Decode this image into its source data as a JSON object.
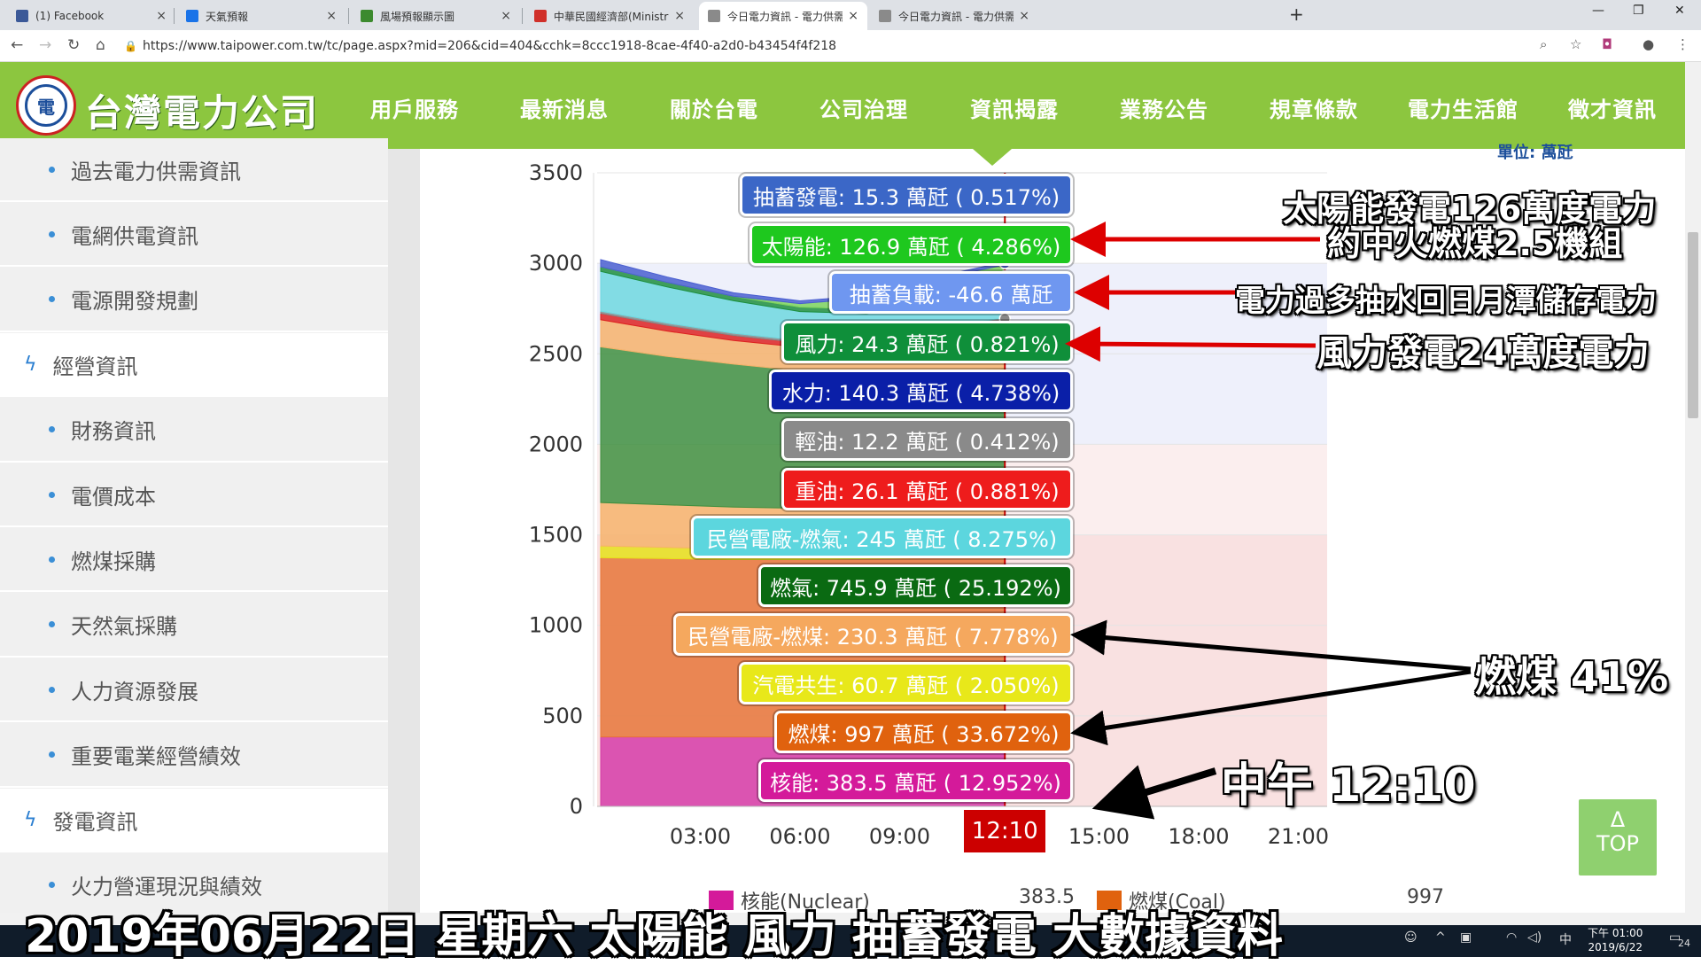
{
  "browser": {
    "tabs": [
      {
        "title": "(1) Facebook",
        "icon_color": "#3b5998",
        "active": false
      },
      {
        "title": "天氣預報",
        "icon_color": "#1a73e8",
        "active": false
      },
      {
        "title": "風場預報顯示圖",
        "icon_color": "#3c8a2e",
        "active": false
      },
      {
        "title": "中華民國經濟部(Ministry of Econ",
        "icon_color": "#d0302a",
        "active": false
      },
      {
        "title": "今日電力資訊 - 電力供需資訊 - 台",
        "icon_color": "#8a8a8a",
        "active": true
      },
      {
        "title": "今日電力資訊 - 電力供需資訊 - 台",
        "icon_color": "#8a8a8a",
        "active": false
      }
    ],
    "url": "https://www.taipower.com.tw/tc/page.aspx?mid=206&cid=404&cchk=8ccc1918-8cae-4f40-a2d0-b43454f4f218",
    "window": {
      "minimize": "—",
      "maximize": "❐",
      "close": "✕"
    }
  },
  "site": {
    "logo_text": "台灣電力公司",
    "logo_mark": "電",
    "menu": [
      "用戶服務",
      "最新消息",
      "關於台電",
      "公司治理",
      "資訊揭露",
      "業務公告",
      "規章條款",
      "電力生活館",
      "徵才資訊"
    ],
    "active_menu": "資訊揭露"
  },
  "sidebar": [
    {
      "label": "過去電力供需資訊",
      "type": "sub"
    },
    {
      "label": "電網供電資訊",
      "type": "sub"
    },
    {
      "label": "電源開發規劃",
      "type": "sub"
    },
    {
      "label": "經營資訊",
      "type": "cat"
    },
    {
      "label": "財務資訊",
      "type": "sub"
    },
    {
      "label": "電價成本",
      "type": "sub"
    },
    {
      "label": "燃煤採購",
      "type": "sub"
    },
    {
      "label": "天然氣採購",
      "type": "sub"
    },
    {
      "label": "人力資源發展",
      "type": "sub"
    },
    {
      "label": "重要電業經營績效",
      "type": "sub"
    },
    {
      "label": "發電資訊",
      "type": "cat"
    },
    {
      "label": "火力營運現況與績效",
      "type": "sub"
    }
  ],
  "unit_label": "單位: 萬瓩",
  "chart_data": {
    "type": "area",
    "title": "",
    "ylabel": "",
    "ylim": [
      0,
      3500
    ],
    "yticks": [
      0,
      500,
      1000,
      1500,
      2000,
      2500,
      3000,
      3500
    ],
    "xticks": [
      "03:00",
      "06:00",
      "09:00",
      "12:10",
      "15:00",
      "18:00",
      "21:00"
    ],
    "current_time": "12:10",
    "x": [
      "00:00",
      "02:00",
      "04:00",
      "06:00",
      "08:00",
      "10:00",
      "12:10"
    ],
    "stack_order": [
      "核能",
      "燃煤",
      "汽電共生",
      "民營電廠-燃煤",
      "燃氣",
      "民營電廠-燃氣",
      "重油",
      "輕油",
      "水力",
      "風力",
      "太陽能",
      "抽蓄發電"
    ],
    "series": [
      {
        "name": "核能",
        "color": "#d63ba8",
        "values": [
          383.5,
          383.5,
          383.5,
          383.5,
          383.5,
          383.5,
          383.5
        ]
      },
      {
        "name": "燃煤",
        "color": "#e8763a",
        "values": [
          990,
          985,
          980,
          980,
          985,
          990,
          997
        ]
      },
      {
        "name": "汽電共生",
        "color": "#e6e11a",
        "values": [
          65,
          62,
          60,
          58,
          59,
          60,
          60.7
        ]
      },
      {
        "name": "民營電廠-燃煤",
        "color": "#f6b26b",
        "values": [
          240,
          235,
          230,
          225,
          228,
          230,
          230.3
        ]
      },
      {
        "name": "燃氣",
        "color": "#3f8f3f",
        "values": [
          860,
          820,
          790,
          760,
          740,
          730,
          745.9
        ]
      },
      {
        "name": "民營電廠-燃氣",
        "color": "#f6b26b",
        "values": [
          150,
          140,
          130,
          130,
          140,
          200,
          245
        ]
      },
      {
        "name": "重油",
        "color": "#dd2222",
        "values": [
          35,
          32,
          28,
          25,
          25,
          26,
          26.1
        ]
      },
      {
        "name": "輕油",
        "color": "#888888",
        "values": [
          12,
          12,
          12,
          12,
          12,
          12,
          12.2
        ]
      },
      {
        "name": "水力",
        "color": "#6fd8df",
        "values": [
          220,
          200,
          180,
          160,
          150,
          140,
          140.3
        ]
      },
      {
        "name": "風力",
        "color": "#1e8f3f",
        "values": [
          25,
          25,
          24,
          24,
          24,
          24,
          24.3
        ]
      },
      {
        "name": "太陽能",
        "color": "#7dd35e",
        "values": [
          0,
          0,
          0,
          20,
          60,
          110,
          126.9
        ]
      },
      {
        "name": "抽蓄發電",
        "color": "#4a5fd0",
        "values": [
          40,
          30,
          20,
          15,
          15,
          15,
          15.3
        ]
      }
    ]
  },
  "tooltips": [
    {
      "text": "抽蓄發電: 15.3 萬瓩 ( 0.517%)",
      "color": "#3b67c7",
      "text_color": "#ffffff"
    },
    {
      "text": "太陽能: 126.9 萬瓩 ( 4.286%)",
      "color": "#1ec81e",
      "text_color": "#ffffff"
    },
    {
      "text": "抽蓄負載: -46.6 萬瓩",
      "color": "#6f97f0",
      "text_color": "#ffffff"
    },
    {
      "text": "風力: 24.3 萬瓩 ( 0.821%)",
      "color": "#0f8f3a",
      "text_color": "#ffffff"
    },
    {
      "text": "水力: 140.3 萬瓩 ( 4.738%)",
      "color": "#0a1fa8",
      "text_color": "#ffffff"
    },
    {
      "text": "輕油: 12.2 萬瓩 ( 0.412%)",
      "color": "#8a8a8a",
      "text_color": "#ffffff"
    },
    {
      "text": "重油: 26.1 萬瓩 ( 0.881%)",
      "color": "#ee1c1c",
      "text_color": "#ffffff"
    },
    {
      "text": "民營電廠-燃氣: 245 萬瓩 ( 8.275%)",
      "color": "#5cd6de",
      "text_color": "#ffffff"
    },
    {
      "text": "燃氣: 745.9 萬瓩 ( 25.192%)",
      "color": "#0a6a12",
      "text_color": "#ffffff"
    },
    {
      "text": "民營電廠-燃煤: 230.3 萬瓩 ( 7.778%)",
      "color": "#f5a85e",
      "text_color": "#ffffff"
    },
    {
      "text": "汽電共生: 60.7 萬瓩 ( 2.050%)",
      "color": "#e8e81a",
      "text_color": "#ffffff"
    },
    {
      "text": "燃煤: 997 萬瓩 ( 33.672%)",
      "color": "#e0620e",
      "text_color": "#ffffff"
    },
    {
      "text": "核能: 383.5 萬瓩 ( 12.952%)",
      "color": "#d41a9a",
      "text_color": "#ffffff"
    }
  ],
  "annotations": {
    "solar_line1": "太陽能發電126萬度電力",
    "solar_line2": "約中火燃煤2.5機組",
    "pump": "電力過多抽水回日月潭儲存電力",
    "wind": "風力發電24萬度電力",
    "coal": "燃煤 41%",
    "noon": "中午 12:10",
    "caption": "2019年06月22日 星期六  太陽能  風力 抽蓄發電 大數據資料"
  },
  "legend_row": [
    {
      "label": "核能(Nuclear)",
      "value": "383.5",
      "color": "#d41a9a"
    },
    {
      "label": "燃煤(Coal)",
      "value": "997",
      "color": "#e0620e"
    }
  ],
  "totop": {
    "arrow": "Δ",
    "label": "TOP"
  },
  "taskbar": {
    "time": "下午 01:00",
    "date": "2019/6/22",
    "notif_count": "24"
  }
}
